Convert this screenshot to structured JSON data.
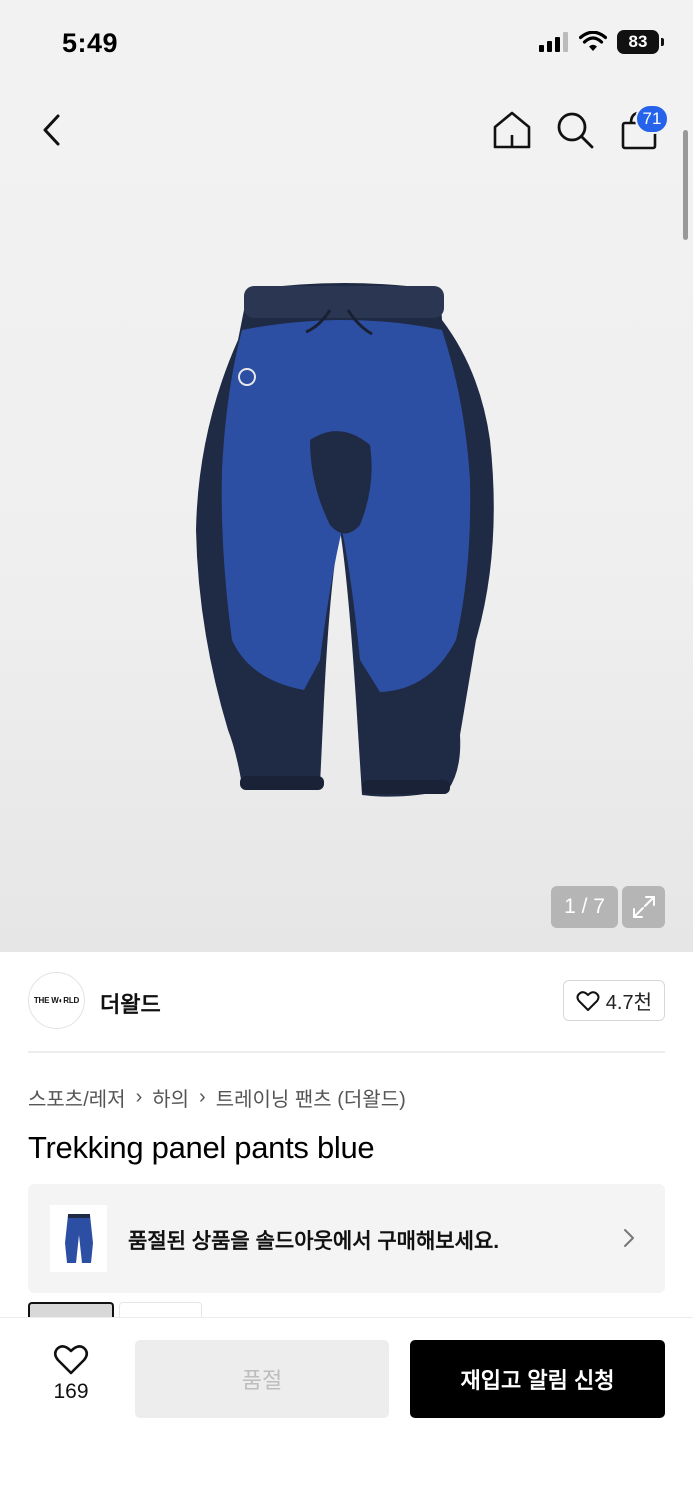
{
  "status_bar": {
    "time": "5:49",
    "battery": "83"
  },
  "nav": {
    "cart_count": "71"
  },
  "gallery": {
    "counter": "1 / 7"
  },
  "brand": {
    "logo_text": "THE W◐RLD",
    "name": "더왈드",
    "likes": "4.7천"
  },
  "breadcrumb": {
    "items": [
      "스포츠/레저",
      "하의",
      "트레이닝 팬츠 (더왈드)"
    ]
  },
  "product": {
    "title": "Trekking panel pants blue"
  },
  "soldout_banner": {
    "text": "품절된 상품을 솔드아웃에서 구매해보세요."
  },
  "bottom_bar": {
    "fav_count": "169",
    "soldout_label": "품절",
    "restock_label": "재입고 알림 신청"
  },
  "colors": {
    "accent_badge": "#2563eb",
    "primary_button": "#000000",
    "disabled_button": "#ededed",
    "pants_blue": "#2d4fa3",
    "pants_navy": "#1f2a44"
  },
  "icons": [
    "back-chevron-icon",
    "home-icon",
    "search-icon",
    "shopping-bag-icon",
    "expand-icon",
    "heart-icon",
    "chevron-right-icon",
    "signal-icon",
    "wifi-icon",
    "battery-icon"
  ]
}
